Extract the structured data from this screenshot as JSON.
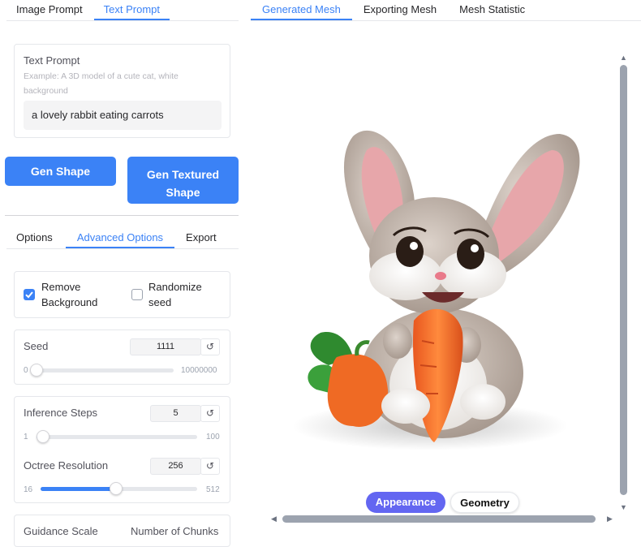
{
  "left_tabs": [
    "Image Prompt",
    "Text Prompt"
  ],
  "right_tabs": [
    "Generated Mesh",
    "Exporting Mesh",
    "Mesh Statistic"
  ],
  "text_prompt": {
    "label": "Text Prompt",
    "placeholder": "Example: A 3D model of a cute cat, white background",
    "value": "a lovely rabbit eating carrots"
  },
  "buttons": {
    "gen_shape": "Gen Shape",
    "gen_textured_shape": "Gen Textured Shape"
  },
  "option_tabs": [
    "Options",
    "Advanced Options",
    "Export"
  ],
  "checkboxes": {
    "remove_background": {
      "label": "Remove Background",
      "checked": true
    },
    "randomize_seed": {
      "label": "Randomize seed",
      "checked": false
    }
  },
  "seed": {
    "label": "Seed",
    "value": "1111",
    "min": "0",
    "max": "10000000",
    "fraction": 0.0
  },
  "inference_steps": {
    "label": "Inference Steps",
    "value": "5",
    "min": "1",
    "max": "100",
    "fraction": 0.04
  },
  "octree_resolution": {
    "label": "Octree Resolution",
    "value": "256",
    "min": "16",
    "max": "512",
    "fraction": 0.48
  },
  "bottom_labels": {
    "guidance_scale": "Guidance Scale",
    "number_of_chunks": "Number of Chunks"
  },
  "reset_symbol": "↺",
  "viewer": {
    "appearance": "Appearance",
    "geometry": "Geometry"
  },
  "colors": {
    "accent": "#3b82f6",
    "appearance_pill": "#6366f1"
  }
}
